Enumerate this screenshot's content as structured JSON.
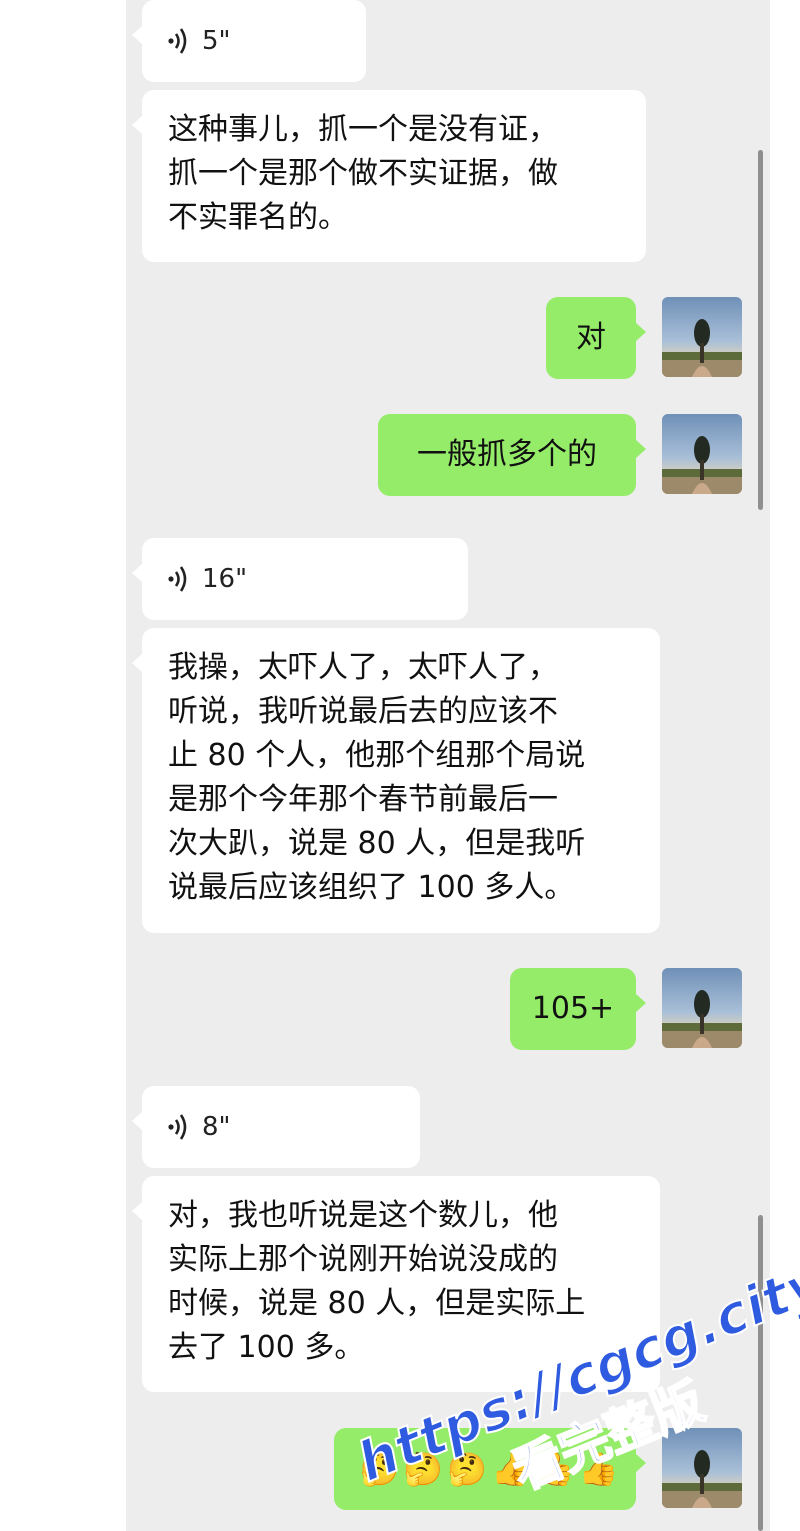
{
  "messages": [
    {
      "type": "voice",
      "side": "in",
      "duration": "5\""
    },
    {
      "type": "text",
      "side": "in",
      "lines": [
        "这种事儿，抓一个是没有证，",
        "抓一个是那个做不实证据，做",
        "不实罪名的。"
      ]
    },
    {
      "type": "text",
      "side": "out",
      "text": "对"
    },
    {
      "type": "text",
      "side": "out",
      "text": "一般抓多个的"
    },
    {
      "type": "voice",
      "side": "in",
      "duration": "16\""
    },
    {
      "type": "text",
      "side": "in",
      "lines": [
        "我操，太吓人了，太吓人了，",
        "听说，我听说最后去的应该不",
        "止 80 个人，他那个组那个局说",
        "是那个今年那个春节前最后一",
        "次大趴，说是 80 人，但是我听",
        "说最后应该组织了 100 多人。"
      ]
    },
    {
      "type": "text",
      "side": "out",
      "text": "105+"
    },
    {
      "type": "voice",
      "side": "in",
      "duration": "8\""
    },
    {
      "type": "text",
      "side": "in",
      "lines": [
        "对，我也听说是这个数儿，他",
        "实际上那个说刚开始说没成的",
        "时候，说是 80 人，但是实际上",
        "去了 100 多。"
      ]
    },
    {
      "type": "emoji",
      "side": "out",
      "emojis": [
        "🤔",
        "🤔",
        "🤔",
        "👍",
        "👍",
        "👍"
      ]
    }
  ],
  "watermark": {
    "line1": "https://cgcg.city",
    "line2": "看完整版",
    "color": "#2f5be0"
  },
  "colors": {
    "chat_bg": "#ededed",
    "incoming": "#ffffff",
    "outgoing": "#95ec69"
  },
  "icons": {
    "voice": "voice-wave-icon",
    "avatar": "avatar-tree-photo"
  }
}
